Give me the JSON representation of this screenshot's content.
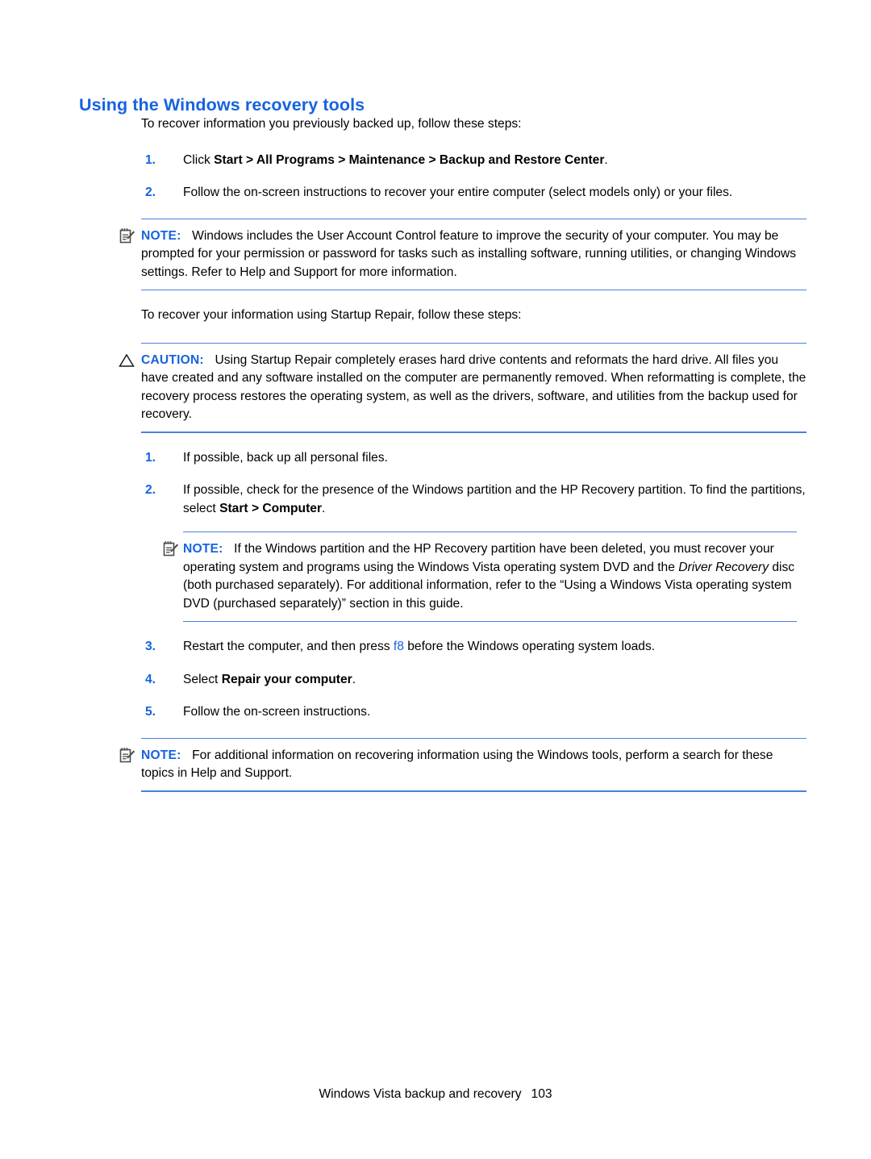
{
  "document": {
    "heading": "Using the Windows recovery tools",
    "intro_1": "To recover information you previously backed up, follow these steps:",
    "intro_2": "To recover your information using Startup Repair, follow these steps:"
  },
  "steps_group_1": [
    {
      "number": "1.",
      "prefix": "Click ",
      "bold": "Start > All Programs > Maintenance > Backup and Restore Center",
      "suffix": "."
    },
    {
      "number": "2.",
      "text": "Follow the on-screen instructions to recover your entire computer (select models only) or your files."
    }
  ],
  "note_1": {
    "icon": "note-pad-icon",
    "label": "NOTE:",
    "text": "Windows includes the User Account Control feature to improve the security of your computer. You may be prompted for your permission or password for tasks such as installing software, running utilities, or changing Windows settings. Refer to Help and Support for more information."
  },
  "caution_1": {
    "icon": "warning-triangle-icon",
    "label": "CAUTION:",
    "text": "Using Startup Repair completely erases hard drive contents and reformats the hard drive. All files you have created and any software installed on the computer are permanently removed. When reformatting is complete, the recovery process restores the operating system, as well as the drivers, software, and utilities from the backup used for recovery."
  },
  "steps_group_2": [
    {
      "number": "1.",
      "text": "If possible, back up all personal files."
    },
    {
      "number": "2.",
      "prefix": "If possible, check for the presence of the Windows partition and the HP Recovery partition. To find the partitions, select ",
      "bold": "Start > Computer",
      "suffix": "."
    },
    {
      "number": "3.",
      "prefix": "Restart the computer, and then press ",
      "key": "f8",
      "suffix": " before the Windows operating system loads."
    },
    {
      "number": "4.",
      "prefix": "Select ",
      "bold": "Repair your computer",
      "suffix": "."
    },
    {
      "number": "5.",
      "text": "Follow the on-screen instructions."
    }
  ],
  "note_2": {
    "icon": "note-pad-icon",
    "label": "NOTE:",
    "part_1": "If the Windows partition and the HP Recovery partition have been deleted, you must recover your operating system and programs using the Windows Vista operating system DVD and the ",
    "italic": "Driver Recovery",
    "part_2": " disc (both purchased separately). For additional information, refer to the “Using a Windows Vista operating system DVD (purchased separately)” section in this guide."
  },
  "note_3": {
    "icon": "note-pad-icon",
    "label": "NOTE:",
    "text": "For additional information on recovering information using the Windows tools, perform a search for these topics in Help and Support."
  },
  "footer": {
    "title": "Windows Vista backup and recovery",
    "page_number": "103"
  },
  "colors": {
    "accent_blue": "#1663e0",
    "rule_blue": "#4b7fe0",
    "text_black": "#000000",
    "icon_gray": "#4d4d4d"
  }
}
